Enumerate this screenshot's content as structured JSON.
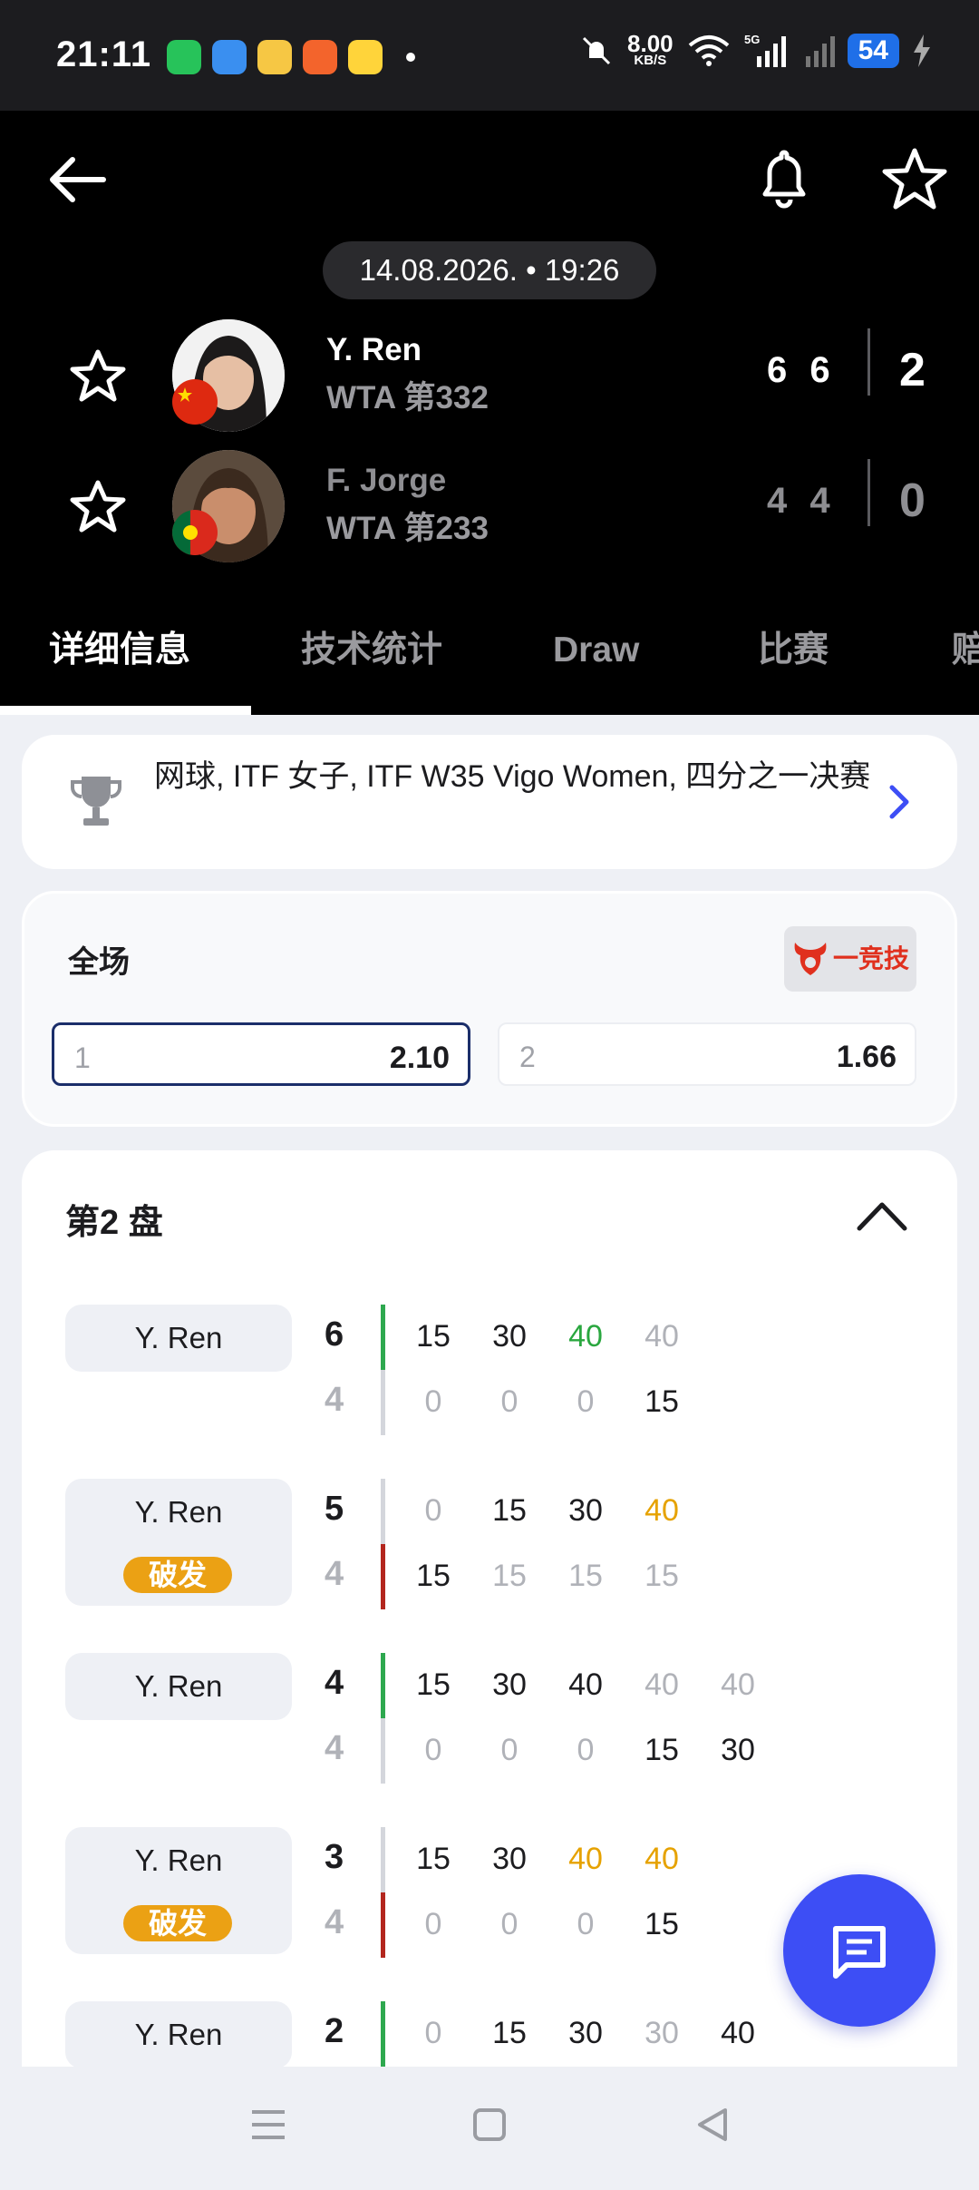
{
  "status_bar": {
    "time": "21:11",
    "net_speed": "8.00",
    "net_unit": "KB/S",
    "network": "5G",
    "battery": "54",
    "apps": [
      "green-app-icon",
      "blue-app-icon",
      "weibo-icon",
      "orange-app-icon",
      "yellow-app-icon"
    ]
  },
  "header": {
    "datetime": "14.08.2026. • 19:26"
  },
  "players": [
    {
      "name": "Y. Ren",
      "rank": "WTA 第332",
      "sets": "6 6",
      "total": "2",
      "flag": "china-flag"
    },
    {
      "name": "F. Jorge",
      "rank": "WTA 第233",
      "sets": "4 4",
      "total": "0",
      "flag": "portugal-flag"
    }
  ],
  "tabs": [
    "详细信息",
    "技术统计",
    "Draw",
    "比赛",
    "赔"
  ],
  "competition": {
    "text": "网球, ITF 女子, ITF W35 Vigo Women, 四分之一决赛"
  },
  "odds": {
    "title": "全场",
    "bookmaker": "一竞技",
    "options": [
      {
        "label": "1",
        "value": "2.10"
      },
      {
        "label": "2",
        "value": "1.66"
      }
    ]
  },
  "set_section": {
    "title": "第2 盘",
    "break_label": "破发",
    "games": [
      {
        "server": "Y. Ren",
        "a": "6",
        "b": "4",
        "a_pts": [
          "15",
          "30",
          "40",
          "40"
        ],
        "b_pts": [
          "0",
          "0",
          "0",
          "15"
        ]
      },
      {
        "server": "Y. Ren",
        "a": "5",
        "b": "4",
        "a_pts": [
          "0",
          "15",
          "30",
          "40"
        ],
        "b_pts": [
          "15",
          "15",
          "15",
          "15"
        ]
      },
      {
        "server": "Y. Ren",
        "a": "4",
        "b": "4",
        "a_pts": [
          "15",
          "30",
          "40",
          "40",
          "40"
        ],
        "b_pts": [
          "0",
          "0",
          "0",
          "15",
          "30"
        ]
      },
      {
        "server": "Y. Ren",
        "a": "3",
        "b": "4",
        "a_pts": [
          "15",
          "30",
          "40",
          "40"
        ],
        "b_pts": [
          "0",
          "0",
          "0",
          "15"
        ]
      },
      {
        "server": "Y. Ren",
        "a": "2",
        "b": "",
        "a_pts": [
          "0",
          "15",
          "30",
          "30",
          "40"
        ],
        "b_pts": []
      }
    ]
  },
  "colors": {
    "accent_blue": "#3d4ef5",
    "break_orange": "#eba114",
    "point_green": "#2aa73f",
    "point_orange": "#e6a200",
    "bar_green": "#2ea84f",
    "bar_red": "#b3261e"
  }
}
